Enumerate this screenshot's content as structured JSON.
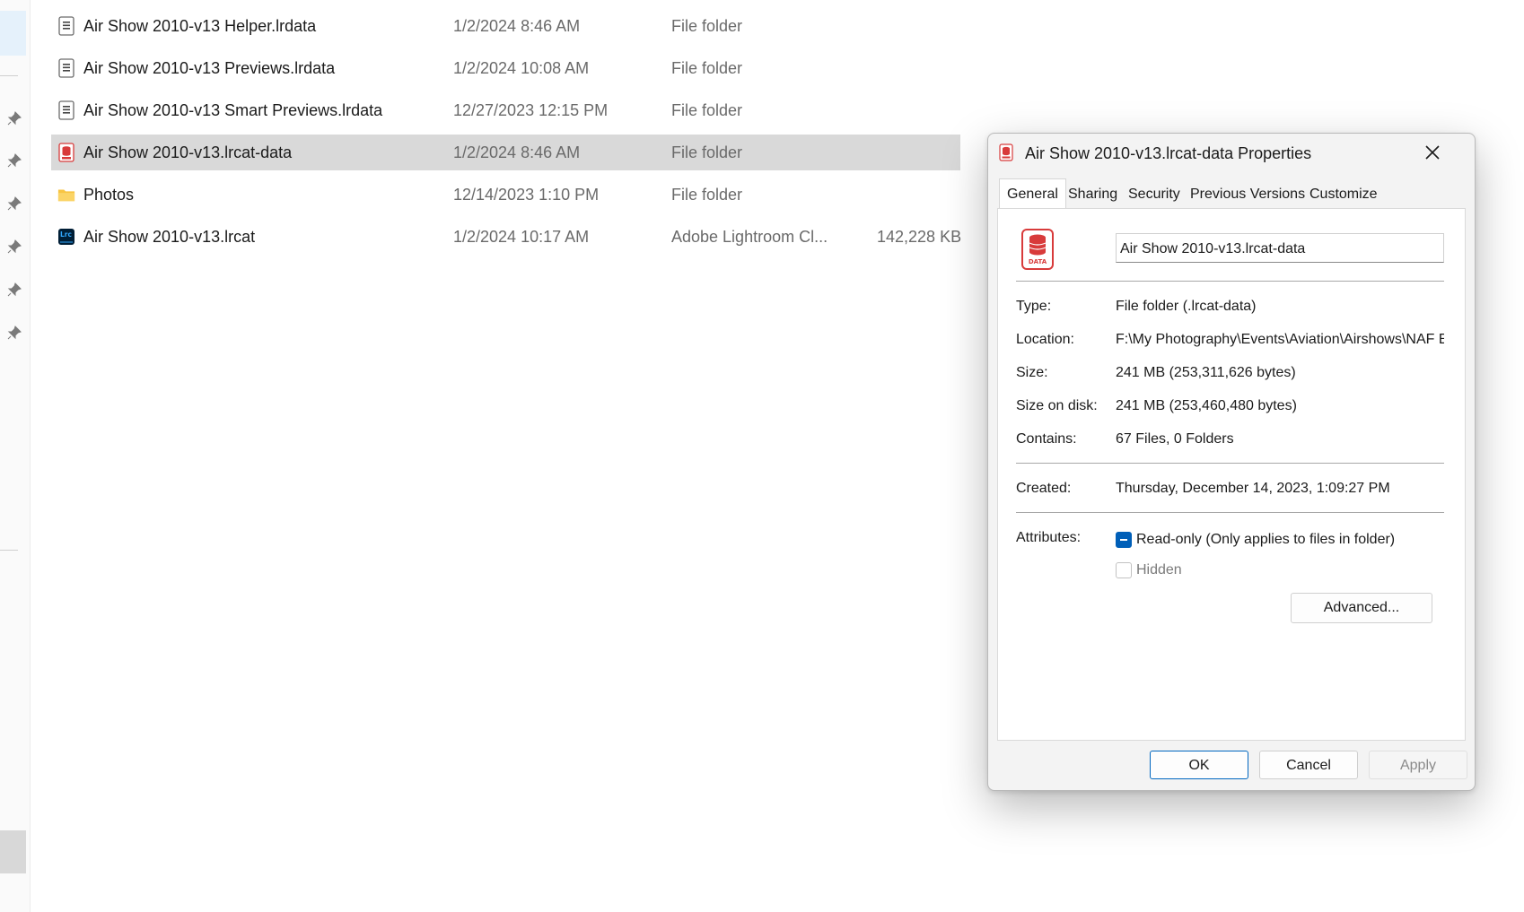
{
  "files": [
    {
      "name": "Air Show 2010-v13 Helper.lrdata",
      "date": "1/2/2024 8:46 AM",
      "type": "File folder",
      "size": "",
      "icon": "lrdata-icon",
      "selected": false
    },
    {
      "name": "Air Show 2010-v13 Previews.lrdata",
      "date": "1/2/2024 10:08 AM",
      "type": "File folder",
      "size": "",
      "icon": "lrdata-icon",
      "selected": false
    },
    {
      "name": "Air Show 2010-v13 Smart Previews.lrdata",
      "date": "12/27/2023 12:15 PM",
      "type": "File folder",
      "size": "",
      "icon": "lrdata-icon",
      "selected": false
    },
    {
      "name": "Air Show 2010-v13.lrcat-data",
      "date": "1/2/2024 8:46 AM",
      "type": "File folder",
      "size": "",
      "icon": "data-icon",
      "selected": true
    },
    {
      "name": "Photos",
      "date": "12/14/2023 1:10 PM",
      "type": "File folder",
      "size": "",
      "icon": "folder-icon",
      "selected": false
    },
    {
      "name": "Air Show 2010-v13.lrcat",
      "date": "1/2/2024 10:17 AM",
      "type": "Adobe Lightroom Cl...",
      "size": "142,228 KB",
      "icon": "lightroom-icon",
      "selected": false
    }
  ],
  "dialog": {
    "title": "Air Show 2010-v13.lrcat-data Properties",
    "tabs": [
      "General",
      "Sharing",
      "Security",
      "Previous Versions",
      "Customize"
    ],
    "active_tab": "General",
    "name_value": "Air Show 2010-v13.lrcat-data",
    "labels": {
      "type": "Type:",
      "location": "Location:",
      "size": "Size:",
      "size_on_disk": "Size on disk:",
      "contains": "Contains:",
      "created": "Created:",
      "attributes": "Attributes:"
    },
    "values": {
      "type": "File folder (.lrcat-data)",
      "location": "F:\\My Photography\\Events\\Aviation\\Airshows\\NAF El",
      "size": "241 MB (253,311,626 bytes)",
      "size_on_disk": "241 MB (253,460,480 bytes)",
      "contains": "67 Files, 0 Folders",
      "created": "Thursday, December 14, 2023, 1:09:27 PM"
    },
    "attributes": {
      "readonly_label": "Read-only (Only applies to files in folder)",
      "readonly_state": "indeterminate",
      "hidden_label": "Hidden",
      "hidden_checked": false,
      "advanced_label": "Advanced..."
    },
    "buttons": {
      "ok": "OK",
      "cancel": "Cancel",
      "apply": "Apply"
    }
  },
  "colors": {
    "selection": "#d9d9d9",
    "accent": "#005fb8",
    "folder": "#f8c543",
    "data_icon": "#d83b3b",
    "lightroom": "#001e36"
  }
}
